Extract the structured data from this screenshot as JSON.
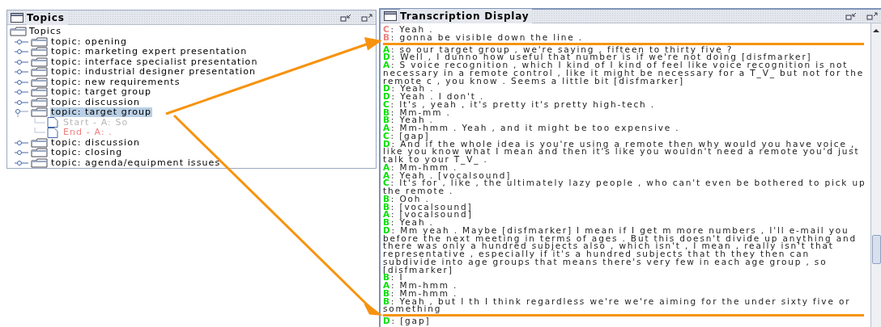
{
  "topics_panel": {
    "title": "Topics",
    "tree": {
      "label": "Topics",
      "expanded": true,
      "children": [
        {
          "label": "topic: opening",
          "expanded": false,
          "selected": false
        },
        {
          "label": "topic: marketing expert presentation",
          "expanded": false,
          "selected": false
        },
        {
          "label": "topic: interface specialist presentation",
          "expanded": false,
          "selected": false
        },
        {
          "label": "topic: industrial designer presentation",
          "expanded": false,
          "selected": false
        },
        {
          "label": "topic: new requirements",
          "expanded": false,
          "selected": false
        },
        {
          "label": "topic: target group",
          "expanded": false,
          "selected": false
        },
        {
          "label": "topic: discussion",
          "expanded": false,
          "selected": false
        },
        {
          "label": "topic: target group",
          "expanded": true,
          "selected": true,
          "children": [
            {
              "label": "Start - A: So",
              "color": "#b8b8b8"
            },
            {
              "label": "End - A: .",
              "color": "#f08080"
            }
          ]
        },
        {
          "label": "topic: discussion",
          "expanded": false,
          "selected": false
        },
        {
          "label": "topic: closing",
          "expanded": false,
          "selected": false
        },
        {
          "label": "topic: agenda/equipment issues",
          "expanded": false,
          "selected": false
        }
      ]
    }
  },
  "transcription_panel": {
    "title": "Transcription Display",
    "utterances": [
      {
        "speaker": "C",
        "color": "#f08080",
        "text": ": Yeah ."
      },
      {
        "speaker": "B",
        "color": "#f08080",
        "text": ": gonna be visible down the line ."
      },
      {
        "speaker": "A",
        "color": "#00e000",
        "text": ": so our target group , we're saying , fifteen to thirty five ?"
      },
      {
        "speaker": "D",
        "color": "#00e000",
        "text": ": Well , I dunno how useful that number is if we're not doing [disfmarker]"
      },
      {
        "speaker": "A",
        "color": "#00e000",
        "text": ": S voice recognition , which I kind of I kind of feel like voice recognition is not necessary in a remote control , like it might be necessary for a T_V_ but not for the remote c , you know . Seems a little bit [disfmarker]"
      },
      {
        "speaker": "D",
        "color": "#00e000",
        "text": ": Yeah ."
      },
      {
        "speaker": "D",
        "color": "#00e000",
        "text": ": Yeah . I don't ."
      },
      {
        "speaker": "C",
        "color": "#00e000",
        "text": ": It's , yeah , it's pretty it's pretty high-tech ."
      },
      {
        "speaker": "B",
        "color": "#00e000",
        "text": ": Mm-mm ."
      },
      {
        "speaker": "B",
        "color": "#00e000",
        "text": ": Yeah ."
      },
      {
        "speaker": "A",
        "color": "#00e000",
        "text": ": Mm-hmm . Yeah , and it might be too expensive ."
      },
      {
        "speaker": "C",
        "color": "#00e000",
        "text": ": [gap]"
      },
      {
        "speaker": "D",
        "color": "#00e000",
        "text": ": And if the whole idea is you're using a remote then why would you have voice , like you know what I mean and then it's like you wouldn't need a remote you'd just talk to your T_V_ ."
      },
      {
        "speaker": "A",
        "color": "#00e000",
        "text": ": Mm-hmm ."
      },
      {
        "speaker": "A",
        "color": "#00e000",
        "text": ": Yeah . [vocalsound]"
      },
      {
        "speaker": "C",
        "color": "#00e000",
        "text": ": It's for , like , the ultimately lazy people , who can't even be bothered to pick up the remote ."
      },
      {
        "speaker": "B",
        "color": "#00e000",
        "text": ": Ooh ."
      },
      {
        "speaker": "B",
        "color": "#00e000",
        "text": ": [vocalsound]"
      },
      {
        "speaker": "A",
        "color": "#00e000",
        "text": ": [vocalsound]"
      },
      {
        "speaker": "B",
        "color": "#00e000",
        "text": ": Yeah ."
      },
      {
        "speaker": "D",
        "color": "#00e000",
        "text": ": Mm yeah . Maybe [disfmarker] I mean if I get m more numbers , I'll e-mail you before the next meeting in terms of ages . But this doesn't divide up anything and there was only a hundred subjects also , which isn't , I mean , really isn't that representative , especially if it's a hundred subjects that th they then can subdivide into age groups that means there's very few in each age group , so [disfmarker]"
      },
      {
        "speaker": "B",
        "color": "#00e000",
        "text": ": I"
      },
      {
        "speaker": "A",
        "color": "#00e000",
        "text": ": Mm-hmm ."
      },
      {
        "speaker": "B",
        "color": "#00e000",
        "text": ": Mm-hmm ."
      },
      {
        "speaker": "B",
        "color": "#00e000",
        "text": ": Yeah , but I th I think regardless we're we're aiming for the under sixty five or something"
      },
      {
        "speaker": "D",
        "color": "#00e000",
        "text": ": [gap]"
      }
    ]
  }
}
